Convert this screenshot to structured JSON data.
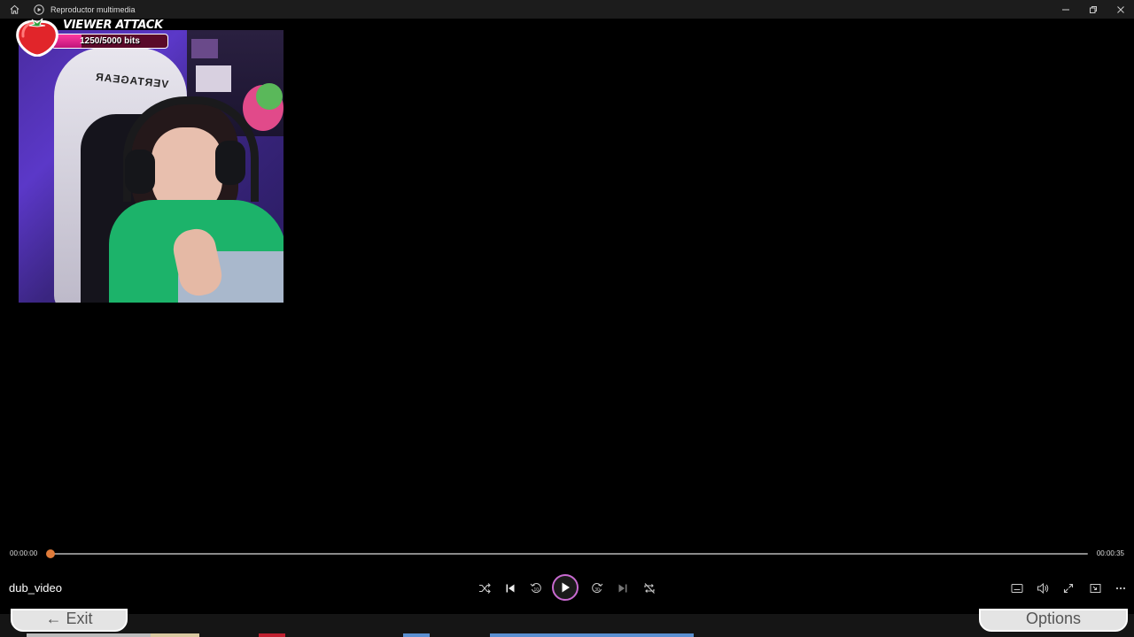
{
  "window": {
    "title": "Reproductor multimedia"
  },
  "overlay": {
    "title": "VIEWER ATTACK",
    "progress_text": "1250/5000 bits",
    "progress_fraction": 0.25
  },
  "chair": {
    "brand": "VERTAGEAR"
  },
  "playback": {
    "current_time": "00:00:00",
    "total_time": "00:00:35",
    "media_title": "dub_video",
    "progress_fraction": 0
  },
  "buttons": {
    "exit": "Exit",
    "options": "Options"
  },
  "icons": {
    "home": "home-icon",
    "app": "media-player-icon",
    "shuffle": "shuffle-icon",
    "previous": "previous-icon",
    "rewind": "rewind-10-icon",
    "play": "play-icon",
    "forward": "forward-30-icon",
    "next": "next-icon",
    "repeat": "repeat-off-icon",
    "subtitles": "subtitles-icon",
    "volume": "volume-icon",
    "fullscreen": "fullscreen-icon",
    "miniplayer": "miniplayer-icon",
    "more": "more-icon"
  },
  "colors": {
    "accent": "#e07b3a",
    "play_ring": "#c86ad0",
    "overlay_fill": "#ff3aa0"
  }
}
